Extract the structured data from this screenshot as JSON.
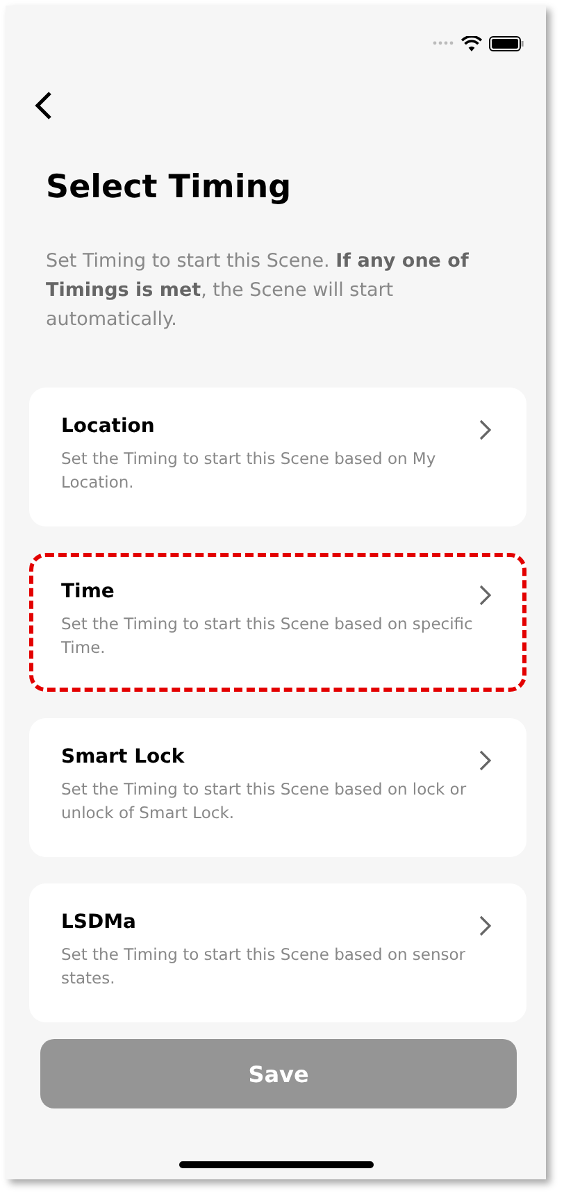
{
  "title": "Select Timing",
  "description": "Set Timing to start this Scene. **If any one of Timings is met**, the Scene will start automatically.",
  "options": [
    {
      "title": "Location",
      "description": "Set the Timing to start this Scene based on My Location.",
      "highlighted": false
    },
    {
      "title": "Time",
      "description": "Set the Timing to start this Scene based on specific Time.",
      "highlighted": true
    },
    {
      "title": "Smart Lock",
      "description": "Set the Timing to start this Scene based on lock or unlock of Smart Lock.",
      "highlighted": false
    },
    {
      "title": "LSDMa",
      "description": "Set the Timing to start this Scene based on sensor states.",
      "highlighted": false
    }
  ],
  "save_button": {
    "label": "Save",
    "disabled": true
  }
}
